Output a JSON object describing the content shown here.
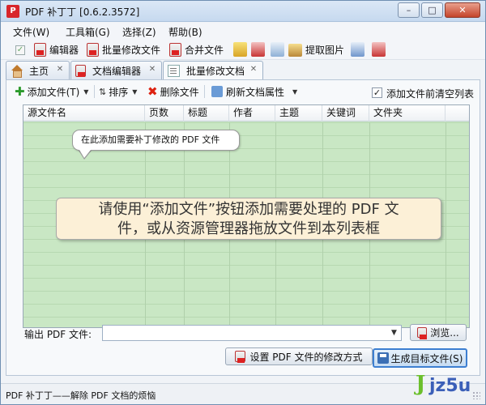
{
  "window": {
    "title": "PDF 补丁丁 [0.6.2.3572]",
    "buttons": [
      "–",
      "□",
      "✕"
    ]
  },
  "menu": [
    "文件(W)",
    "工具箱(G)",
    "选择(Z)",
    "帮助(B)"
  ],
  "toolbar": {
    "editor_label": "编辑器",
    "batch_label": "批量修改文件",
    "merge_label": "合并文件",
    "extract_images_label": "提取图片"
  },
  "tabs": [
    {
      "label": "主页"
    },
    {
      "label": "文档编辑器"
    },
    {
      "label": "批量修改文档"
    }
  ],
  "subtoolbar": {
    "add_files_label": "添加文件(T)",
    "sort_label": "排序",
    "delete_files_label": "删除文件",
    "refresh_label": "刷新文档属性",
    "clear_before_add_label": "添加文件前清空列表",
    "clear_before_add_checked": true
  },
  "table": {
    "columns": [
      "源文件名",
      "页数",
      "标题",
      "作者",
      "主题",
      "关键词",
      "文件夹"
    ]
  },
  "tooltip": "在此添加需要补丁修改的 PDF 文件",
  "hint": {
    "line1": "请使用“添加文件”按钮添加需要处理的 PDF 文",
    "line2": "件，或从资源管理器拖放文件到本列表框"
  },
  "output": {
    "label": "输出 PDF 文件:",
    "value": "",
    "browse_label": "浏览..."
  },
  "actions": {
    "modify_label": "设置 PDF 文件的修改方式",
    "generate_label": "生成目标文件(S)"
  },
  "status": "PDF 补丁丁——解除 PDF 文档的烦恼",
  "watermark": {
    "j": "J",
    "rest": "jz5u"
  },
  "colors": {
    "list_bg": "#c9e7c4",
    "hint_bg": "#fcf0d7",
    "accent": "#3d7fd1"
  }
}
